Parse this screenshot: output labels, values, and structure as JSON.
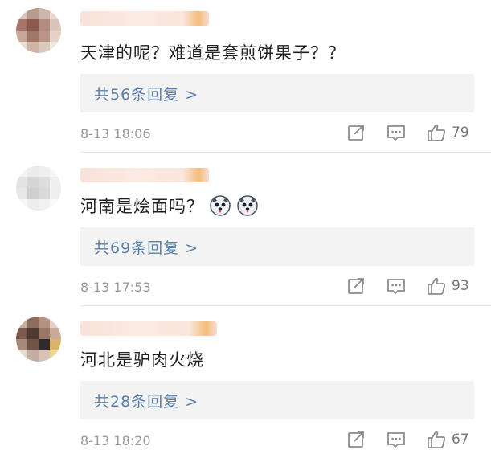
{
  "comments": [
    {
      "text": "天津的呢？难道是套煎饼果子？？",
      "replies": "共56条回复 >",
      "time": "8-13 18:06",
      "likes": "79"
    },
    {
      "text": "河南是烩面吗？",
      "replies": "共69条回复 >",
      "time": "8-13 17:53",
      "likes": "93",
      "emoji": [
        "husky-emoji",
        "husky-emoji"
      ]
    },
    {
      "text": "河北是驴肉火烧",
      "replies": "共28条回复 >",
      "time": "8-13 18:20",
      "likes": "67"
    }
  ],
  "icons": {
    "share": "share-icon",
    "comment": "comment-icon",
    "like": "thumbs-up-icon"
  },
  "colors": {
    "reply_link": "#5b7fa8",
    "reply_bg": "#f3f3f4",
    "meta_text": "#9a9a9a"
  }
}
